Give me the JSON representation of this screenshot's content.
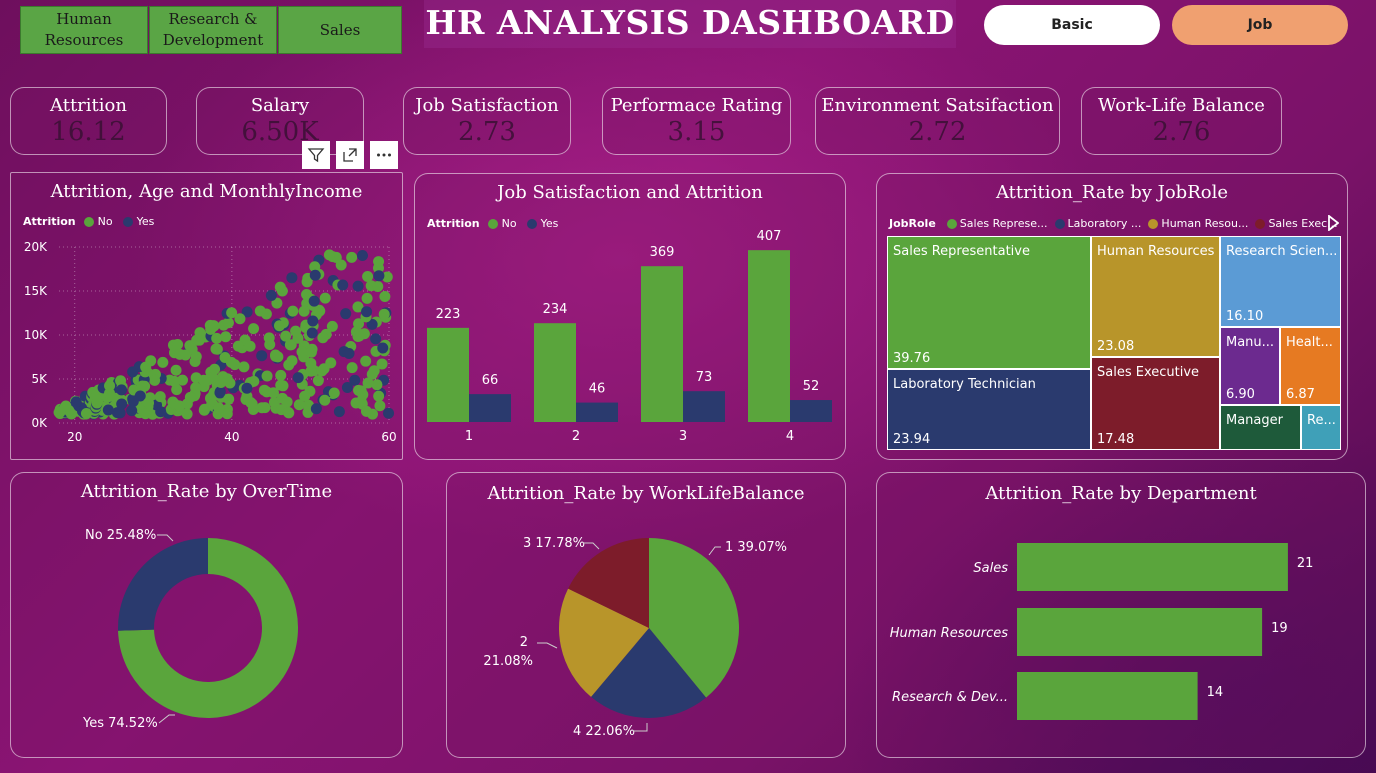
{
  "header": {
    "title": "HR ANALYSIS DASHBOARD",
    "slicers": [
      "Human Resources",
      "Research & Development",
      "Sales"
    ],
    "nav": {
      "basic": "Basic",
      "job": "Job"
    }
  },
  "colors": {
    "no": "#5aa53c",
    "yes": "#2a3a6e",
    "accent": "#f0a070"
  },
  "kpis": [
    {
      "label": "Attrition",
      "value": "16.12"
    },
    {
      "label": "Salary",
      "value": "6.50K"
    },
    {
      "label": "Job Satisfaction",
      "value": "2.73"
    },
    {
      "label": "Performace Rating",
      "value": "3.15"
    },
    {
      "label": "Environment Satsifaction",
      "value": "2.72"
    },
    {
      "label": "Work-Life Balance",
      "value": "2.76"
    }
  ],
  "legend_common": {
    "title": "Attrition",
    "no": "No",
    "yes": "Yes"
  },
  "chart_data": [
    {
      "type": "scatter",
      "title": "Attrition, Age and MonthlyIncome",
      "x_ticks": [
        "20",
        "40",
        "60"
      ],
      "y_ticks": [
        "0K",
        "5K",
        "10K",
        "15K",
        "20K"
      ],
      "xlim": [
        18,
        60
      ],
      "ylim": [
        0,
        20000
      ],
      "series": [
        {
          "name": "No"
        },
        {
          "name": "Yes"
        }
      ]
    },
    {
      "type": "bar",
      "title": "Job Satisfaction and Attrition",
      "categories": [
        "1",
        "2",
        "3",
        "4"
      ],
      "series": [
        {
          "name": "No",
          "values": [
            223,
            234,
            369,
            407
          ]
        },
        {
          "name": "Yes",
          "values": [
            66,
            46,
            73,
            52
          ]
        }
      ],
      "ylim": [
        0,
        450
      ]
    },
    {
      "type": "treemap",
      "title": "Attrition_Rate by JobRole",
      "legend_title": "JobRole",
      "legend_items": [
        "Sales Represe...",
        "Laboratory ...",
        "Human Resou...",
        "Sales Exec..."
      ],
      "items": [
        {
          "label": "Sales Representative",
          "value": "39.76",
          "color": "#5aa53c"
        },
        {
          "label": "Laboratory Technician",
          "value": "23.94",
          "color": "#2a3a6e"
        },
        {
          "label": "Human Resources",
          "value": "23.08",
          "color": "#b8952a"
        },
        {
          "label": "Sales Executive",
          "value": "17.48",
          "color": "#7d1c2a"
        },
        {
          "label": "Research Scien...",
          "value": "16.10",
          "color": "#5b9bd5"
        },
        {
          "label": "Manu...",
          "value": "6.90",
          "color": "#6c2a8f"
        },
        {
          "label": "Healt...",
          "value": "6.87",
          "color": "#e67a22"
        },
        {
          "label": "Manager",
          "value": "",
          "color": "#1e5a3a"
        },
        {
          "label": "Re...",
          "value": "",
          "color": "#3fa0b8"
        }
      ]
    },
    {
      "type": "pie",
      "title": "Attrition_Rate by OverTime",
      "donut": true,
      "slices": [
        {
          "label": "Yes 74.52%",
          "value": 74.52,
          "color": "#5aa53c"
        },
        {
          "label": "No 25.48%",
          "value": 25.48,
          "color": "#2a3a6e"
        }
      ]
    },
    {
      "type": "pie",
      "title": "Attrition_Rate by WorkLifeBalance",
      "slices": [
        {
          "label": "1 39.07%",
          "value": 39.07,
          "color": "#5aa53c"
        },
        {
          "label": "4 22.06%",
          "value": 22.06,
          "color": "#2a3a6e"
        },
        {
          "label": "2 21.08%",
          "label_line1": "2",
          "label_line2": "21.08%",
          "value": 21.08,
          "color": "#b8952a"
        },
        {
          "label": "3 17.78%",
          "value": 17.78,
          "color": "#7d1c2a"
        }
      ]
    },
    {
      "type": "bar",
      "orientation": "horizontal",
      "title": "Attrition_Rate by Department",
      "categories": [
        "Sales",
        "Human Resources",
        "Research & Dev..."
      ],
      "values": [
        21,
        19,
        14
      ],
      "xlim": [
        0,
        24
      ]
    }
  ]
}
